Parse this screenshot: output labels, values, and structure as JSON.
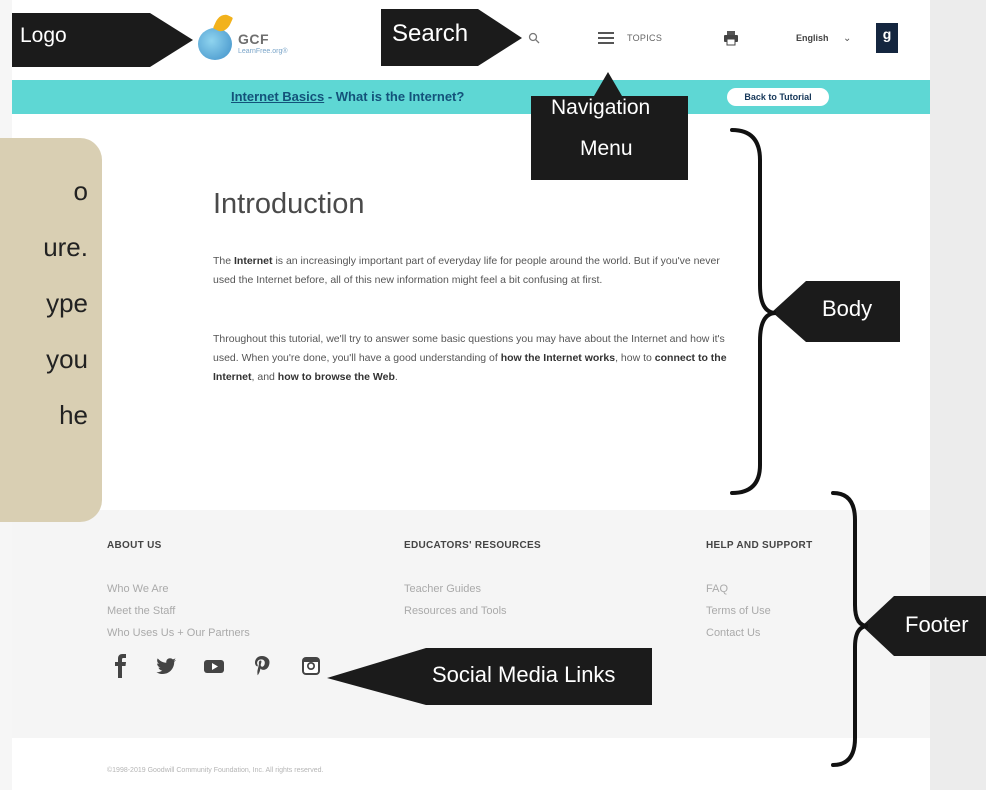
{
  "header": {
    "logo_text": "GCF",
    "logo_subtext": "LearnFree.org®",
    "topics_label": "TOPICS",
    "language_label": "English",
    "language_chevron": "⌄",
    "partner_logo_text": "g",
    "icons": [
      "search-icon",
      "menu-icon",
      "print-icon",
      "goodwill-logo"
    ]
  },
  "subnav": {
    "course_link": "Internet Basics",
    "separator": " - ",
    "page_title": "What is the Internet?",
    "back_button": "Back to Tutorial",
    "background_color": "#5ed7d4"
  },
  "body": {
    "heading": "Introduction",
    "paragraph1": {
      "pre": "The ",
      "bold": "Internet",
      "post": " is an increasingly important part of everyday life for people around the world. But if you've never used the Internet before, all of this new information might feel a bit confusing at first."
    },
    "paragraph2": {
      "part1": "Throughout this tutorial, we'll try to answer some basic questions you may have about the Internet and how it's used. When you're done, you'll have a good understanding of ",
      "bold1": "how the Internet works",
      "part2": ", how to ",
      "bold2": "connect to the Internet",
      "part3": ", and ",
      "bold3": "how to browse the Web",
      "part4": "."
    }
  },
  "footer": {
    "columns": [
      {
        "heading": "ABOUT US",
        "links": [
          "Who We Are",
          "Meet the Staff",
          "Who Uses Us + Our Partners"
        ]
      },
      {
        "heading": "EDUCATORS' RESOURCES",
        "links": [
          "Teacher Guides",
          "Resources and Tools"
        ]
      },
      {
        "heading": "HELP AND SUPPORT",
        "links": [
          "FAQ",
          "Terms of Use",
          "Contact Us"
        ]
      }
    ],
    "social_icons": [
      "facebook-icon",
      "twitter-icon",
      "youtube-icon",
      "pinterest-icon",
      "instagram-icon"
    ],
    "copyright": "©1998-2019 Goodwill Community Foundation, Inc. All rights reserved."
  },
  "callout": {
    "lines": [
      "o",
      "ure.",
      "ype",
      "you",
      "he"
    ]
  },
  "annotations": {
    "logo": "Logo",
    "search": "Search",
    "navigation_line1": "Navigation",
    "navigation_line2": "Menu",
    "body": "Body",
    "footer": "Footer",
    "social": "Social Media Links"
  }
}
